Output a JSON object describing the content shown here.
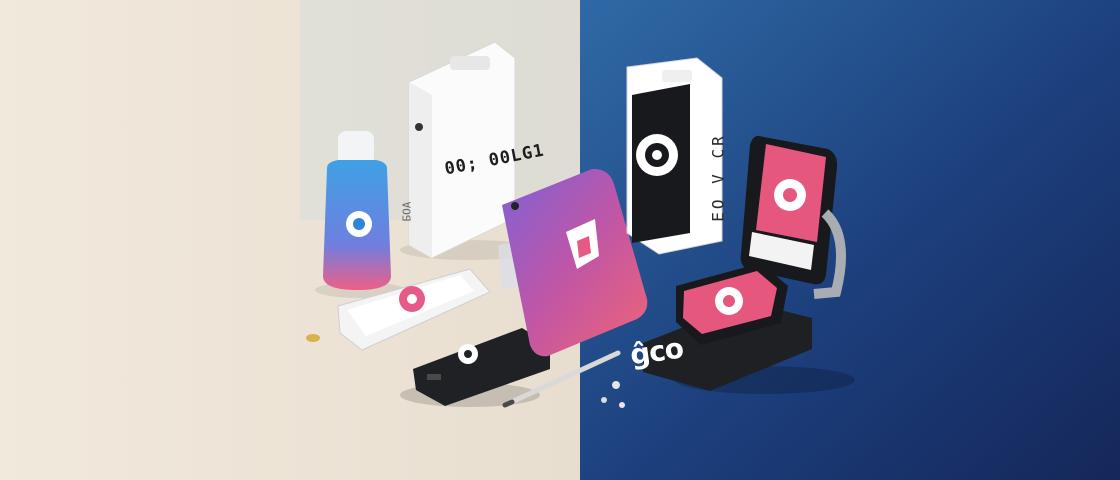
{
  "scene": {
    "printed_text": {
      "white_powerbank": "00; 00LG1",
      "white_powerbank_side": "БОА",
      "dark_device_side": "EO V CR",
      "charging_dock": "ĝco"
    },
    "colors": {
      "left_background": "#efe7db",
      "right_background": "#1f4f8f",
      "brand_pink": "#e65a88",
      "brand_blue": "#2f85d6"
    }
  }
}
